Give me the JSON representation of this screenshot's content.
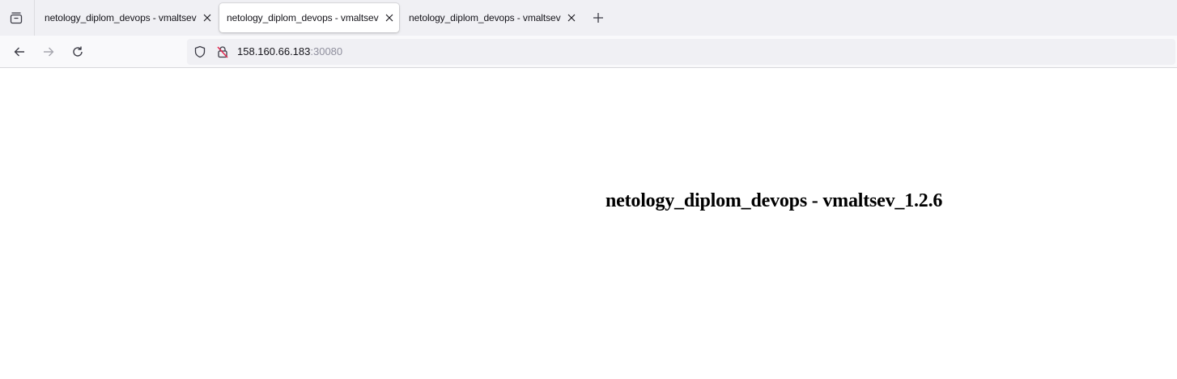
{
  "tabs": [
    {
      "title": "netology_diplom_devops - vmaltsev",
      "active": false
    },
    {
      "title": "netology_diplom_devops - vmaltsev",
      "active": true
    },
    {
      "title": "netology_diplom_devops - vmaltsev",
      "active": false
    }
  ],
  "icons": {
    "tab_list": "tab-list-icon",
    "close": "close-icon",
    "new_tab": "plus-icon",
    "back": "arrow-left-icon",
    "forward": "arrow-right-icon",
    "reload": "reload-icon",
    "tracking_protection": "shield-icon",
    "connection_insecure": "lock-slash-icon"
  },
  "address_bar": {
    "host": "158.160.66.183",
    "port": ":30080"
  },
  "page": {
    "heading": "netology_diplom_devops - vmaltsev_1.2.6"
  },
  "colors": {
    "tabstrip_bg": "#f0f0f4",
    "navbar_bg": "#f9f9fb",
    "insecure_icon": "#e22850"
  }
}
